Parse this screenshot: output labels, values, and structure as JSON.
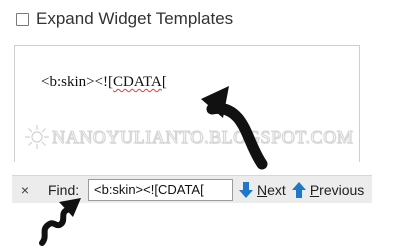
{
  "options": {
    "expand_widget_templates_label": "Expand Widget Templates"
  },
  "editor": {
    "code_prefix": "<b:skin><![",
    "code_highlight": "CDATA",
    "code_suffix": "["
  },
  "watermark": {
    "text": "NANOYULIANTO.BLOGSPOT.COM"
  },
  "find_bar": {
    "close_glyph": "×",
    "label": "Find:",
    "input_value": "<b:skin><![CDATA[",
    "next_label": "Next",
    "previous_label": "Previous"
  },
  "icons": {
    "close": "close-icon",
    "next": "arrow-down-icon",
    "previous": "arrow-up-icon",
    "watermark_logo": "sun-icon",
    "annotation_arrow": "curved-arrow-icon",
    "annotation_squiggle": "squiggle-arrow-icon"
  },
  "colors": {
    "nav_arrow": "#1f77c8",
    "annotation": "#111111",
    "spellcheck": "#e43b3b"
  }
}
